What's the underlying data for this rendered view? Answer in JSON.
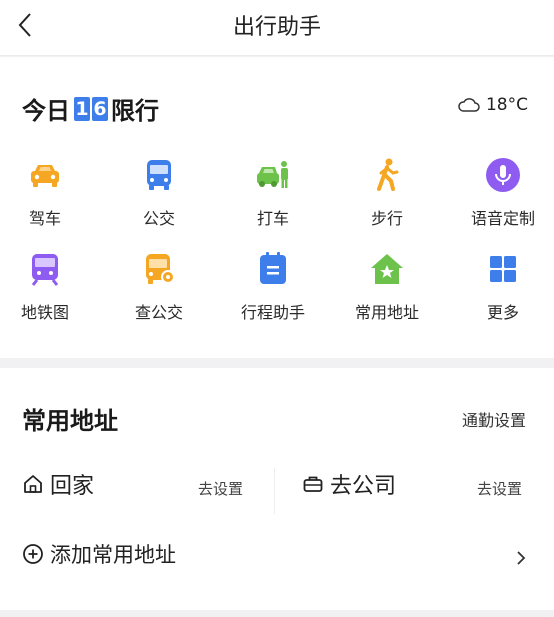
{
  "header": {
    "title": "出行助手"
  },
  "limit": {
    "prefix": "今日",
    "digits": [
      "1",
      "6"
    ],
    "suffix": "限行"
  },
  "weather": {
    "temp": "18°C",
    "icon": "cloud-icon"
  },
  "shortcuts": [
    {
      "label": "驾车",
      "icon": "car-icon",
      "color": "#f5a623"
    },
    {
      "label": "公交",
      "icon": "bus-icon",
      "color": "#3d7eea"
    },
    {
      "label": "打车",
      "icon": "taxi-icon",
      "color": "#6cc24a"
    },
    {
      "label": "步行",
      "icon": "walk-icon",
      "color": "#f5a623"
    },
    {
      "label": "语音定制",
      "icon": "microphone-icon",
      "color": "#8e5cf0"
    },
    {
      "label": "地铁图",
      "icon": "subway-icon",
      "color": "#8e5cf0"
    },
    {
      "label": "查公交",
      "icon": "bus-search-icon",
      "color": "#f5a623"
    },
    {
      "label": "行程助手",
      "icon": "itinerary-icon",
      "color": "#3d7eea"
    },
    {
      "label": "常用地址",
      "icon": "home-star-icon",
      "color": "#6cc24a"
    },
    {
      "label": "更多",
      "icon": "grid-icon",
      "color": "#3d7eea"
    }
  ],
  "favorites": {
    "title": "常用地址",
    "commute_label": "通勤设置",
    "home": {
      "label": "回家",
      "action": "去设置",
      "icon": "house-icon"
    },
    "work": {
      "label": "去公司",
      "action": "去设置",
      "icon": "briefcase-icon"
    },
    "add_label": "添加常用地址"
  }
}
